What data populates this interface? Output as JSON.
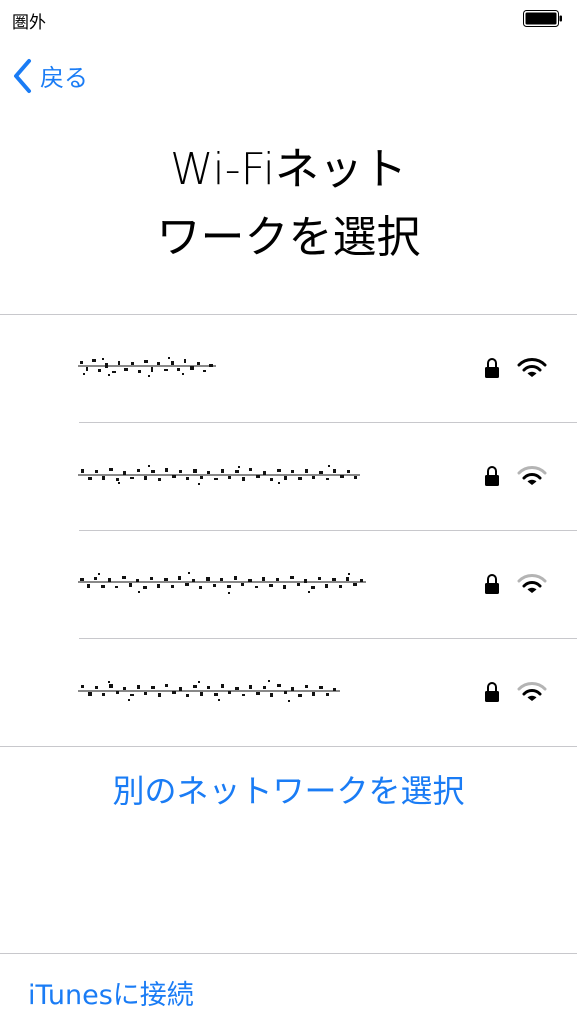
{
  "status_bar": {
    "carrier": "圏外",
    "icons": [
      "battery-icon"
    ]
  },
  "nav": {
    "back_label": "戻る",
    "icons": [
      "chevron-left-icon"
    ]
  },
  "title": {
    "line1": "Wi-Fiネット",
    "line2": "ワークを選択"
  },
  "networks": [
    {
      "name_visible": false,
      "secured": true,
      "signal_bars": 3,
      "icons": [
        "lock-icon",
        "wifi-icon"
      ]
    },
    {
      "name_visible": false,
      "secured": true,
      "signal_bars": 2,
      "icons": [
        "lock-icon",
        "wifi-icon"
      ]
    },
    {
      "name_visible": false,
      "secured": true,
      "signal_bars": 2,
      "icons": [
        "lock-icon",
        "wifi-icon"
      ]
    },
    {
      "name_visible": false,
      "secured": true,
      "signal_bars": 2,
      "icons": [
        "lock-icon",
        "wifi-icon"
      ]
    }
  ],
  "other_network_label": "別のネットワークを選択",
  "itunes_label": "iTunesに接続",
  "colors": {
    "accent": "#1a7cf5",
    "divider": "#c8c8cc",
    "background": "#ffffff",
    "text": "#000000"
  }
}
